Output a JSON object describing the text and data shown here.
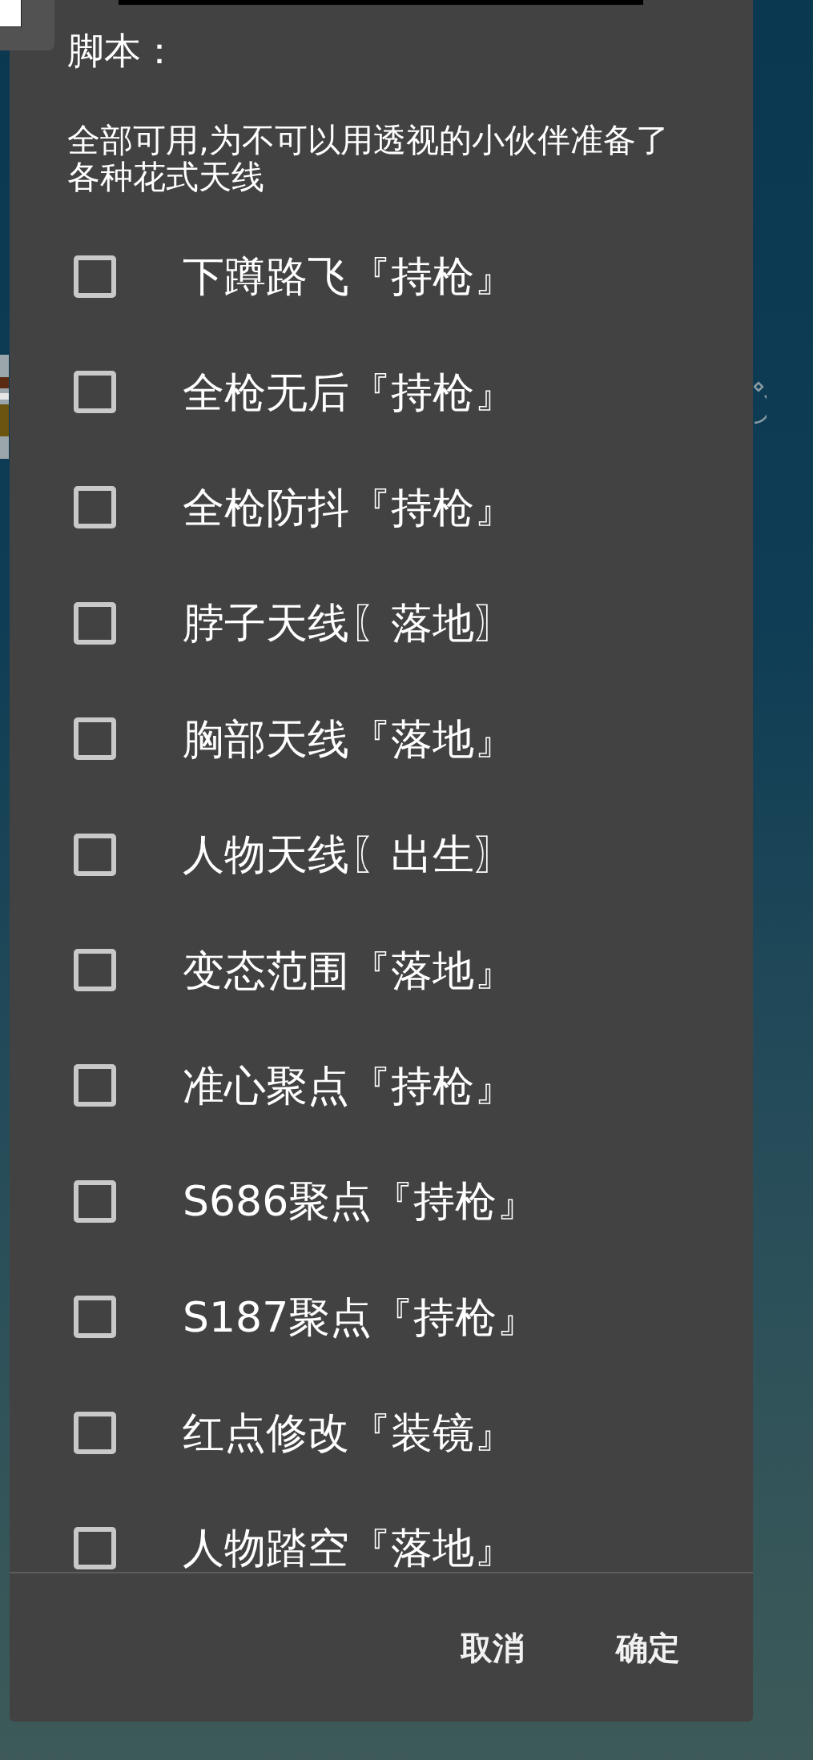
{
  "dialog": {
    "title": "脚本：",
    "message": "全部可用,为不可以用透视的小伙伴准备了各种花式天线",
    "options": [
      {
        "label": "下蹲路飞『持枪』",
        "checked": false
      },
      {
        "label": "全枪无后『持枪』",
        "checked": false
      },
      {
        "label": "全枪防抖『持枪』",
        "checked": false
      },
      {
        "label": "脖子天线〖落地〗",
        "checked": false
      },
      {
        "label": "胸部天线『落地』",
        "checked": false
      },
      {
        "label": "人物天线〖出生〗",
        "checked": false
      },
      {
        "label": "变态范围『落地』",
        "checked": false
      },
      {
        "label": "准心聚点『持枪』",
        "checked": false
      },
      {
        "label": "S686聚点『持枪』",
        "checked": false
      },
      {
        "label": "S187聚点『持枪』",
        "checked": false
      },
      {
        "label": "红点修改『装镜』",
        "checked": false
      },
      {
        "label": "人物踏空『落地』",
        "checked": false
      }
    ],
    "buttons": [
      {
        "label": "取消"
      },
      {
        "label": "确定"
      }
    ]
  }
}
